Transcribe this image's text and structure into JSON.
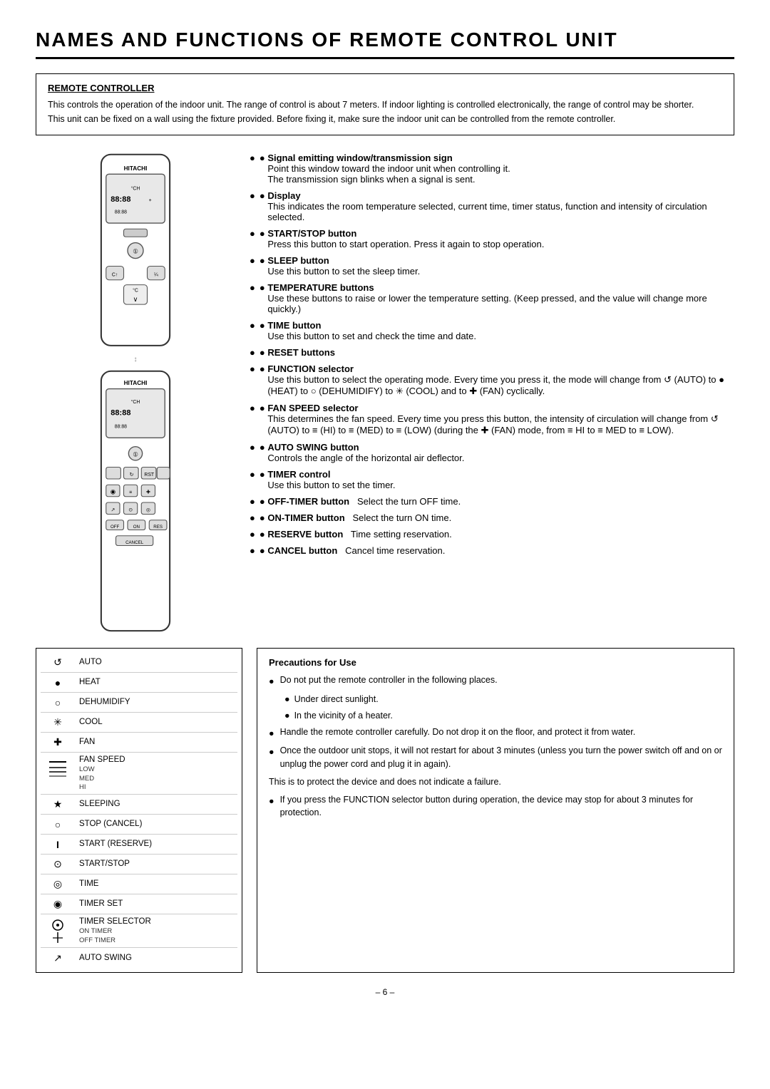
{
  "page": {
    "title": "NAMES AND FUNCTIONS OF REMOTE CONTROL UNIT",
    "page_number": "– 6 –"
  },
  "remote_controller": {
    "section_title": "REMOTE CONTROLLER",
    "paragraphs": [
      "This controls the operation of the indoor unit. The range of control is about 7 meters. If indoor lighting is controlled electronically, the range of control may be shorter.",
      "This unit can be fixed on a wall using the fixture provided. Before fixing it, make sure the indoor unit can be controlled from the remote controller."
    ]
  },
  "annotations": [
    {
      "id": "signal",
      "title": "Signal emitting window/transmission sign",
      "text": "Point this window toward the indoor unit when controlling it.\nThe transmission sign blinks when a signal is sent."
    },
    {
      "id": "display",
      "title": "Display",
      "text": "This indicates the room temperature selected, current time, timer status, function and intensity of circulation selected."
    },
    {
      "id": "startstop",
      "title": "START/STOP button",
      "text": "Press this button to start operation. Press it again to stop operation."
    },
    {
      "id": "sleep",
      "title": "SLEEP button",
      "text": "Use this button to set the sleep timer."
    },
    {
      "id": "temperature",
      "title": "TEMPERATURE buttons",
      "text": "Use these buttons to raise or lower the temperature setting. (Keep pressed, and the value will change more quickly.)"
    },
    {
      "id": "time",
      "title": "TIME button",
      "text": "Use this button to set and check the time and date."
    },
    {
      "id": "reset",
      "title": "RESET buttons",
      "text": ""
    },
    {
      "id": "function",
      "title": "FUNCTION selector",
      "text": "Use this button to select the operating mode. Every time you press it, the mode will change from ↺ (AUTO) to ● (HEAT) to ○ (DEHUMIDIFY) to ✳ (COOL) and to ✚ (FAN) cyclically."
    },
    {
      "id": "fanspeed",
      "title": "FAN SPEED selector",
      "text": "This determines the fan speed. Every time you press this button, the intensity of circulation will change from ↺ (AUTO) to ≡ (HI) to ≡ (MED) to ≡ (LOW) (during the ✚ (FAN) mode, from ≡ HI to ≡ MED to ≡ LOW)."
    },
    {
      "id": "autoswing",
      "title": "AUTO SWING button",
      "text": "Controls the angle of the horizontal air deflector."
    },
    {
      "id": "timer",
      "title": "TIMER control",
      "text": "Use this button to set the timer."
    },
    {
      "id": "offtimer",
      "title": "OFF-TIMER button",
      "text": "Select the turn OFF time.",
      "inline": true
    },
    {
      "id": "ontimer",
      "title": "ON-TIMER button",
      "text": "Select the turn ON time.",
      "inline": true
    },
    {
      "id": "reserve",
      "title": "RESERVE button",
      "text": "Time setting reservation.",
      "inline": true
    },
    {
      "id": "cancel",
      "title": "CANCEL button",
      "text": "Cancel time reservation.",
      "inline": true
    }
  ],
  "legend": [
    {
      "icon": "↺",
      "label": "AUTO",
      "sub": ""
    },
    {
      "icon": "●",
      "label": "HEAT",
      "sub": ""
    },
    {
      "icon": "○",
      "label": "DEHUMIDIFY",
      "sub": ""
    },
    {
      "icon": "✳",
      "label": "COOL",
      "sub": ""
    },
    {
      "icon": "✚",
      "label": "FAN",
      "sub": ""
    },
    {
      "icon": "≡",
      "label": "FAN SPEED",
      "sub": "LOW\nMED\nHI"
    },
    {
      "icon": "★",
      "label": "SLEEPING",
      "sub": ""
    },
    {
      "icon": "○",
      "label": "STOP (CANCEL)",
      "sub": ""
    },
    {
      "icon": "I",
      "label": "START (RESERVE)",
      "sub": ""
    },
    {
      "icon": "①",
      "label": "START/STOP",
      "sub": ""
    },
    {
      "icon": "⊙",
      "label": "TIME",
      "sub": ""
    },
    {
      "icon": "◎",
      "label": "TIMER SET",
      "sub": ""
    },
    {
      "icon": "◉",
      "label": "TIMER SELECTOR\nON TIMER\nOFF TIMER",
      "sub": ""
    },
    {
      "icon": "↗",
      "label": "AUTO SWING",
      "sub": ""
    }
  ],
  "precautions": {
    "title": "Precautions for Use",
    "bullets": [
      "Do not put the remote controller in the following places.",
      "Handle the remote controller carefully. Do not drop it on the floor, and protect it from water.",
      "Once the outdoor unit stops, it will not restart for about 3 minutes (unless you turn the power switch off and on or unplug the power cord and plug it in again).",
      "This is to protect the device and does not indicate a failure.",
      "If you press the FUNCTION selector button during operation, the device may stop for about 3 minutes for protection."
    ],
    "sub_bullets": [
      "Under direct sunlight.",
      "In the vicinity of a heater."
    ]
  }
}
